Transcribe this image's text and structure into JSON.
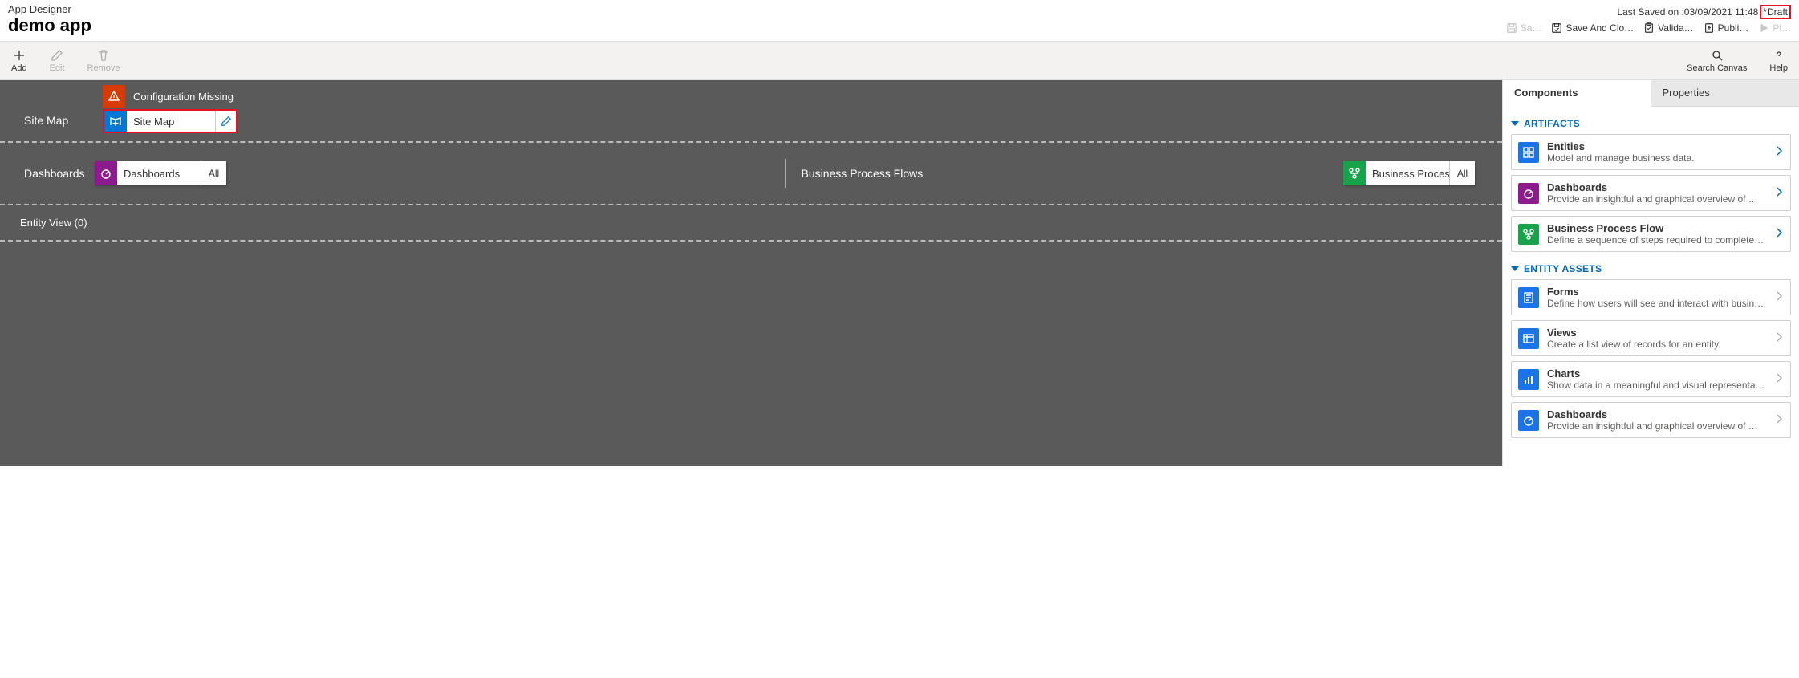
{
  "header": {
    "designer_label": "App Designer",
    "app_name": "demo app",
    "last_saved_prefix": "Last Saved on :",
    "last_saved_value": "03/09/2021 11:48",
    "draft_label": "*Draft",
    "commands": {
      "save": "Sa…",
      "save_close": "Save And Clo…",
      "validate": "Valida…",
      "publish": "Publi…",
      "play": "Pl…"
    }
  },
  "toolbar": {
    "add": "Add",
    "edit": "Edit",
    "remove": "Remove",
    "search": "Search Canvas",
    "help": "Help"
  },
  "canvas": {
    "sitemap_section_label": "Site Map",
    "config_missing": "Configuration Missing",
    "sitemap_tile_label": "Site Map",
    "dashboards_label": "Dashboards",
    "dashboards_tile_label": "Dashboards",
    "dashboards_count": "All",
    "bpf_label": "Business Process Flows",
    "bpf_tile_label": "Business Proces…",
    "bpf_count": "All",
    "entity_view_label": "Entity View (0)"
  },
  "sidepanel": {
    "tab_components": "Components",
    "tab_properties": "Properties",
    "group_artifacts": "ARTIFACTS",
    "group_assets": "ENTITY ASSETS",
    "artifacts": {
      "entities_title": "Entities",
      "entities_desc": "Model and manage business data.",
      "dashboards_title": "Dashboards",
      "dashboards_desc": "Provide an insightful and graphical overview of …",
      "bpf_title": "Business Process Flow",
      "bpf_desc": "Define a sequence of steps required to complete…"
    },
    "assets": {
      "forms_title": "Forms",
      "forms_desc": "Define how users will see and interact with busin…",
      "views_title": "Views",
      "views_desc": "Create a list view of records for an entity.",
      "charts_title": "Charts",
      "charts_desc": "Show data in a meaningful and visual representa…",
      "dashboards_title": "Dashboards",
      "dashboards_desc": "Provide an insightful and graphical overview of …"
    }
  }
}
